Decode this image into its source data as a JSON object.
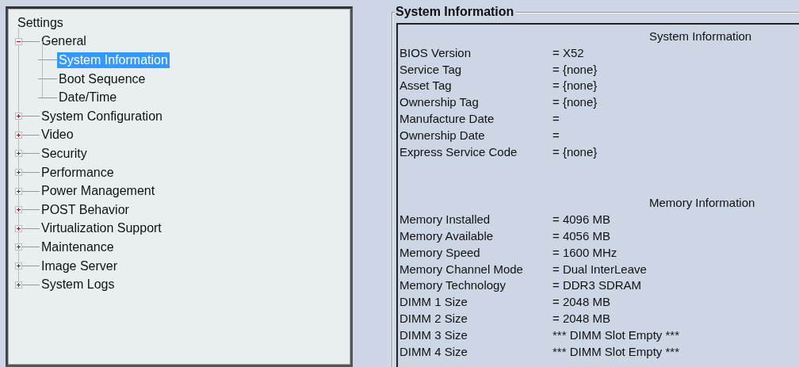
{
  "tree": {
    "root": "Settings",
    "items": [
      {
        "label": "General",
        "expanded": true,
        "selected": false,
        "children": [
          {
            "label": "System Information",
            "selected": true
          },
          {
            "label": "Boot Sequence",
            "selected": false
          },
          {
            "label": "Date/Time",
            "selected": false
          }
        ]
      },
      {
        "label": "System Configuration",
        "expanded": false,
        "selected": false
      },
      {
        "label": "Video",
        "expanded": false,
        "selected": false
      },
      {
        "label": "Security",
        "expanded": false,
        "selected": false
      },
      {
        "label": "Performance",
        "expanded": false,
        "selected": false
      },
      {
        "label": "Power Management",
        "expanded": false,
        "selected": false
      },
      {
        "label": "POST Behavior",
        "expanded": false,
        "selected": false
      },
      {
        "label": "Virtualization Support",
        "expanded": false,
        "selected": false
      },
      {
        "label": "Maintenance",
        "expanded": false,
        "selected": false
      },
      {
        "label": "Image Server",
        "expanded": false,
        "selected": false
      },
      {
        "label": "System Logs",
        "expanded": false,
        "selected": false
      }
    ]
  },
  "details": {
    "title": "System Information",
    "sections": [
      {
        "heading": "System Information",
        "rows": [
          {
            "label": "BIOS Version",
            "value": "= X52"
          },
          {
            "label": "Service Tag",
            "value": "= {none}"
          },
          {
            "label": "Asset Tag",
            "value": "= {none}"
          },
          {
            "label": "Ownership Tag",
            "value": "= {none}"
          },
          {
            "label": "Manufacture Date",
            "value": "="
          },
          {
            "label": "Ownership Date",
            "value": "="
          },
          {
            "label": "Express Service Code",
            "value": "= {none}"
          }
        ]
      },
      {
        "heading": "Memory Information",
        "rows": [
          {
            "label": "Memory Installed",
            "value": "= 4096 MB"
          },
          {
            "label": "Memory Available",
            "value": "= 4056 MB"
          },
          {
            "label": "Memory Speed",
            "value": "= 1600 MHz"
          },
          {
            "label": "Memory Channel Mode",
            "value": "= Dual InterLeave"
          },
          {
            "label": "Memory Technology",
            "value": "= DDR3 SDRAM"
          },
          {
            "label": "DIMM 1 Size",
            "value": "= 2048 MB"
          },
          {
            "label": "DIMM 2 Size",
            "value": "= 2048 MB"
          },
          {
            "label": "DIMM 3 Size",
            "value": "*** DIMM Slot Empty ***"
          },
          {
            "label": "DIMM 4 Size",
            "value": "*** DIMM Slot Empty ***"
          }
        ]
      }
    ]
  }
}
